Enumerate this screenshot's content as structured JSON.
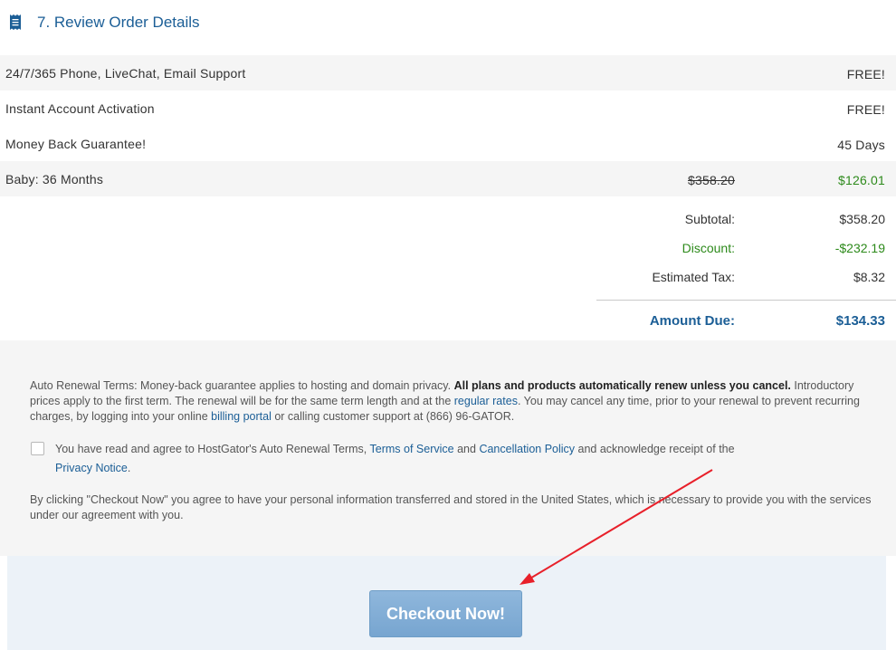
{
  "section": {
    "title": "7. Review Order Details",
    "icon": "receipt-icon"
  },
  "items": [
    {
      "label": "24/7/365 Phone, LiveChat, Email Support",
      "value": "FREE!"
    },
    {
      "label": "Instant Account Activation",
      "value": "FREE!"
    },
    {
      "label": "Money Back Guarantee!",
      "value": "45 Days"
    },
    {
      "label": "Baby: 36 Months",
      "old_price": "$358.20",
      "value": "$126.01"
    }
  ],
  "totals": {
    "subtotal_label": "Subtotal:",
    "subtotal": "$358.20",
    "discount_label": "Discount:",
    "discount": "-$232.19",
    "tax_label": "Estimated Tax:",
    "tax": "$8.32",
    "due_label": "Amount Due:",
    "due": "$134.33"
  },
  "terms": {
    "renewal_text": "Auto Renewal Terms: Money-back guarantee applies to hosting and domain privacy.",
    "renewal_bold": "All plans and products automatically renew unless you cancel.",
    "renewal_text2": "Introductory prices apply to the first term. The renewal will be for the same term length and at the",
    "regular_rates": "regular rates",
    "renewal_text3": ". You may cancel any time, prior to your renewal to prevent recurring charges, by logging into your online",
    "billing_portal": "billing portal",
    "renewal_text4": "or calling customer support at (866) 96-GATOR.",
    "agree_text": "You have read and agree to HostGator's Auto Renewal Terms,",
    "terms_of_service": "Terms of Service",
    "and": "and",
    "cancellation_policy": "Cancellation Policy",
    "agree_text2": "and acknowledge receipt of the",
    "privacy_notice": "Privacy Notice",
    "period": ".",
    "consent_text": "By clicking \"Checkout Now\" you agree to have your personal information transferred and stored in the United States, which is necessary to provide you with the services under our agreement with you."
  },
  "checkout": {
    "label": "Checkout Now!"
  },
  "colors": {
    "brand_blue": "#1b5e96",
    "discount_green": "#2d8a1b",
    "annotation_red": "#e8202a"
  }
}
